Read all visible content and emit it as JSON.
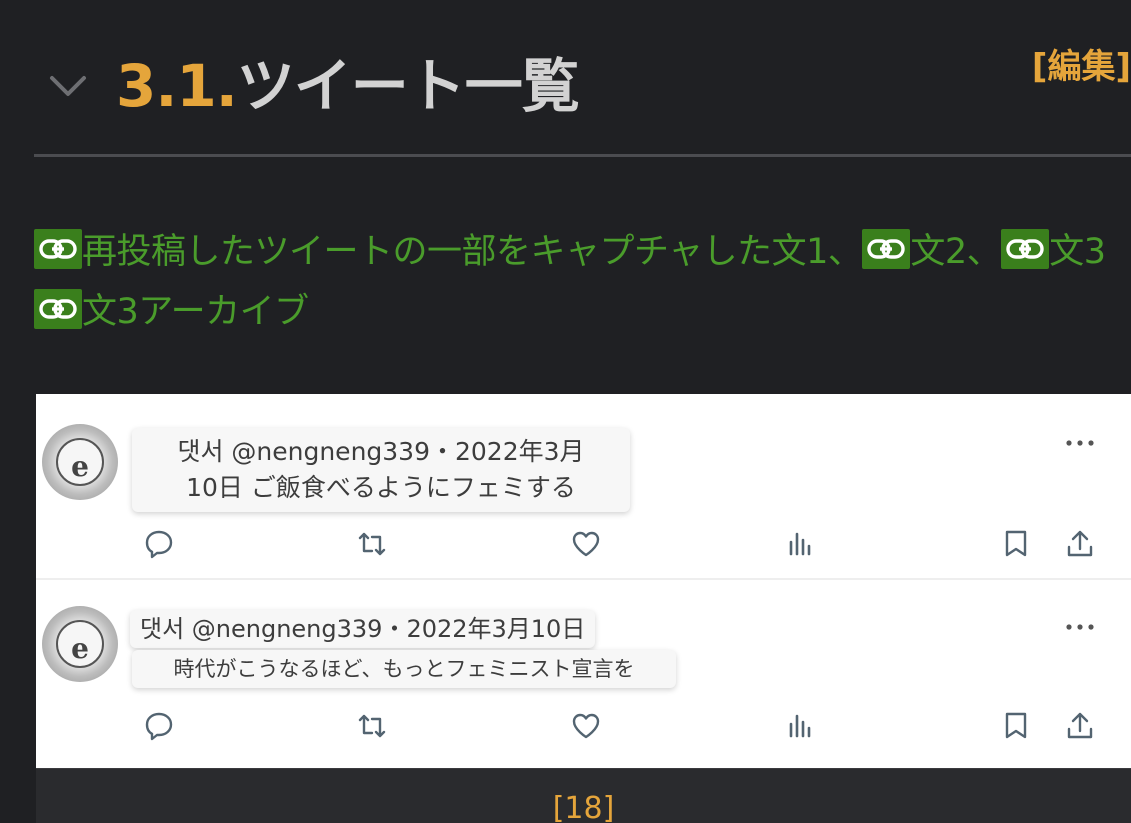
{
  "section": {
    "collapse_icon": "chevron-down-icon",
    "number": "3.1.",
    "title": "ツイート一覧",
    "edit_label": "[編集]"
  },
  "links": {
    "link_icon": "link-icon",
    "item1_label": "再投稿したツイートの一部をキャプチャした文1、",
    "item2_label": "文2、",
    "item3_label": "文3",
    "item4_label": "文3アーカイブ"
  },
  "tweets": [
    {
      "avatar_letter": "e",
      "line1": "댓서 @nengneng339・2022年3月",
      "line2": "10日 ご飯食べるようにフェミする"
    },
    {
      "avatar_letter": "e",
      "line1": "댓서 @nengneng339・2022年3月10日",
      "line2": "時代がこうなるほど、もっとフェミニスト宣言を"
    }
  ],
  "tweet_actions": [
    "reply-icon",
    "retweet-icon",
    "like-icon",
    "views-icon",
    "bookmark-icon",
    "share-icon"
  ],
  "footnote": "[18]",
  "colors": {
    "background": "#1f2023",
    "accent": "#e5a53b",
    "link": "#4a9c2b",
    "link_icon_bg": "#3a7f1c",
    "heading_text": "#d2d2d2"
  }
}
